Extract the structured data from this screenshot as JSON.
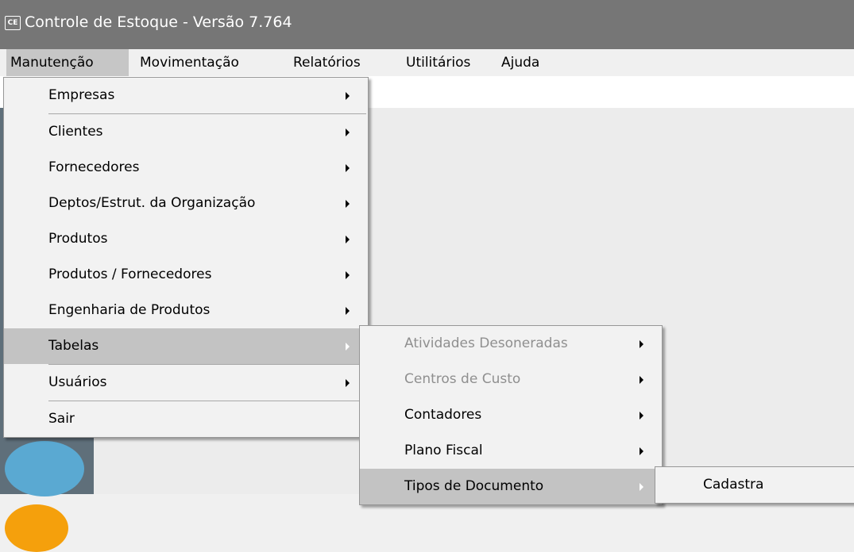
{
  "window": {
    "app_icon": "CE",
    "title": "Controle de Estoque - Versão 7.764"
  },
  "menubar": {
    "items": [
      {
        "label": "Manutenção"
      },
      {
        "label": "Movimentação"
      },
      {
        "label": "Relatórios"
      },
      {
        "label": "Utilitários"
      },
      {
        "label": "Ajuda"
      }
    ]
  },
  "menu_manutencao": {
    "items": [
      {
        "label": "Empresas",
        "has_submenu": true
      },
      {
        "label": "Clientes",
        "has_submenu": true
      },
      {
        "label": "Fornecedores",
        "has_submenu": true
      },
      {
        "label": "Deptos/Estrut. da Organização",
        "has_submenu": true
      },
      {
        "label": "Produtos",
        "has_submenu": true
      },
      {
        "label": "Produtos / Fornecedores",
        "has_submenu": true
      },
      {
        "label": "Engenharia de Produtos",
        "has_submenu": true
      },
      {
        "label": "Tabelas",
        "has_submenu": true,
        "highlighted": true
      },
      {
        "label": "Usuários",
        "has_submenu": true
      },
      {
        "label": "Sair",
        "has_submenu": false
      }
    ]
  },
  "menu_tabelas": {
    "items": [
      {
        "label": "Atividades Desoneradas",
        "disabled": true,
        "has_submenu": true
      },
      {
        "label": "Centros de Custo",
        "disabled": true,
        "has_submenu": true
      },
      {
        "label": "Contadores",
        "has_submenu": true
      },
      {
        "label": "Plano Fiscal",
        "has_submenu": true
      },
      {
        "label": "Tipos de Documento",
        "has_submenu": true,
        "highlighted": true
      }
    ]
  },
  "menu_tipos_documento": {
    "items": [
      {
        "label": "Cadastra"
      }
    ]
  },
  "colors": {
    "titlebar": "#767676",
    "menu_highlight": "#c3c3c3",
    "disabled_text": "#8f8f8f"
  }
}
